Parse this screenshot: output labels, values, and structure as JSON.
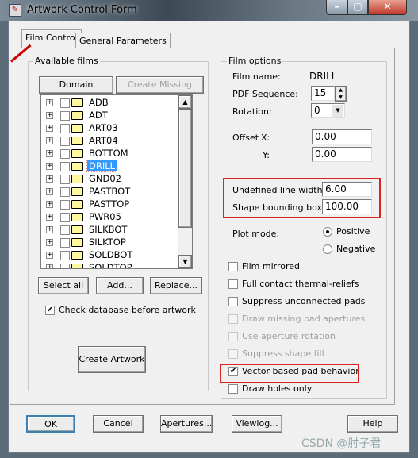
{
  "window": {
    "title": "Artwork Control Form"
  },
  "tabs": [
    {
      "label": "Film Control",
      "active": true
    },
    {
      "label": "General Parameters",
      "active": false
    }
  ],
  "available_films": {
    "label": "Available films",
    "domain_selection": "Domain Selection",
    "create_missing": "Create Missing Films",
    "films": [
      "ADB",
      "ADT",
      "ART03",
      "ART04",
      "BOTTOM",
      "DRILL",
      "GND02",
      "PASTBOT",
      "PASTTOP",
      "PWR05",
      "SILKBOT",
      "SILKTOP",
      "SOLDBOT",
      "SOLDTOP"
    ],
    "selected": "DRILL",
    "select_all": "Select all",
    "add": "Add...",
    "replace": "Replace...",
    "check_db_label": "Check database before artwork",
    "check_db": true,
    "create_artwork": "Create Artwork"
  },
  "film_options": {
    "label": "Film options",
    "film_name_label": "Film name:",
    "film_name": "DRILL",
    "pdf_seq_label": "PDF Sequence:",
    "pdf_seq": "15",
    "rotation_label": "Rotation:",
    "rotation": "0",
    "offset_label": "Offset",
    "x_label": "X:",
    "x": "0.00",
    "y_label": "Y:",
    "y": "0.00",
    "undef_label": "Undefined line width:",
    "undef": "6.00",
    "shape_label": "Shape bounding box:",
    "shape": "100.00",
    "plot_mode_label": "Plot mode:",
    "positive": "Positive",
    "negative": "Negative",
    "plot_mode": "Positive",
    "checks": [
      {
        "label": "Film mirrored",
        "checked": false,
        "enabled": true
      },
      {
        "label": "Full contact thermal-reliefs",
        "checked": false,
        "enabled": true
      },
      {
        "label": "Suppress unconnected pads",
        "checked": false,
        "enabled": true
      },
      {
        "label": "Draw missing pad apertures",
        "checked": false,
        "enabled": false
      },
      {
        "label": "Use aperture rotation",
        "checked": false,
        "enabled": false
      },
      {
        "label": "Suppress shape fill",
        "checked": false,
        "enabled": false
      },
      {
        "label": "Vector based pad behavior",
        "checked": true,
        "enabled": true
      },
      {
        "label": "Draw holes only",
        "checked": false,
        "enabled": true
      }
    ]
  },
  "footer": {
    "ok": "OK",
    "cancel": "Cancel",
    "apertures": "Apertures...",
    "viewlog": "Viewlog...",
    "help": "Help"
  },
  "watermark": "CSDN @肘子君",
  "colors": {
    "highlight": "#d22222",
    "selection": "#3399ff"
  }
}
